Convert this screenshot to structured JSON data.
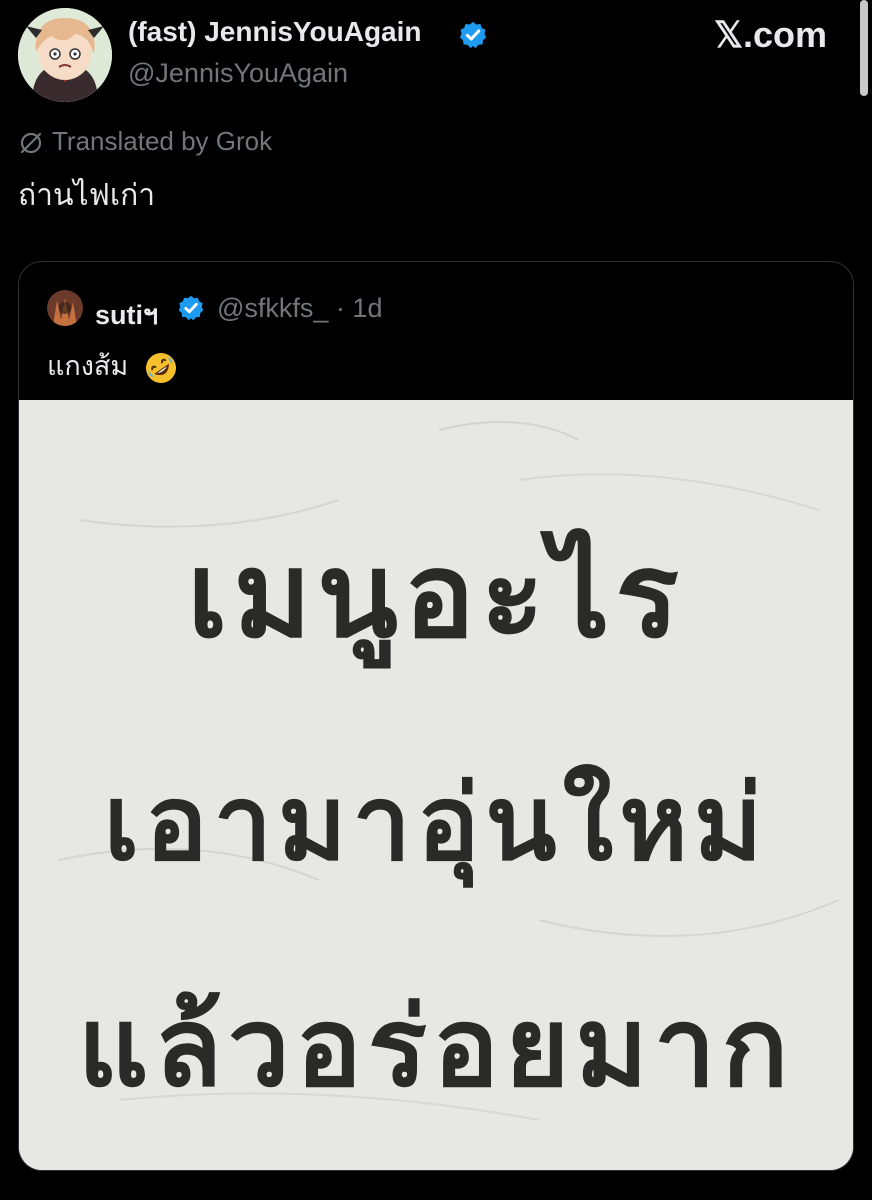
{
  "post": {
    "author": {
      "display_name": "(fast) JennisYouAgain",
      "handle": "@JennisYouAgain",
      "verified": true,
      "avatar_icon": "anime-girl-avatar"
    },
    "brand": "𝕏.com",
    "translation_note": "Translated by Grok",
    "text": "ถ่านไฟเก่า"
  },
  "quote": {
    "author_name": "sutiฯ",
    "verified": true,
    "meta": "@sfkkfs_ · 1d",
    "text": "แกงส้ม",
    "emoji_icon": "rolling-on-floor-laughing-emoji",
    "image": {
      "lines": [
        "เมนูอะไร",
        "เอามาอุ่นใหม่",
        "แล้วอร่อยมาก"
      ]
    }
  },
  "colors": {
    "background": "#000000",
    "text_primary": "#e7e9ea",
    "text_secondary": "#71767b",
    "verified_blue": "#1d9bf0",
    "card_border": "#2f3336",
    "whiteboard": "#e7e8e4",
    "marker_ink": "#2a2a28"
  }
}
